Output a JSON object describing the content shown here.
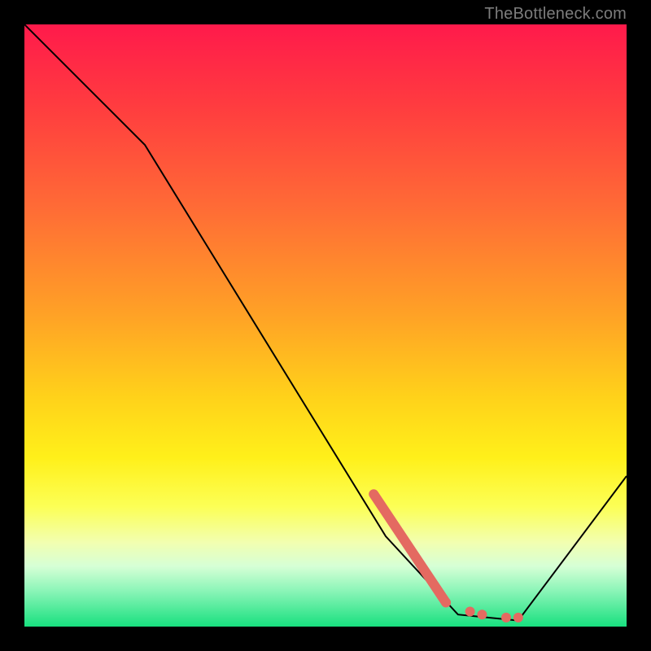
{
  "watermark": {
    "text": "TheBottleneck.com"
  },
  "gradient": {
    "stops": [
      {
        "offset": "0%",
        "color": "#ff1a4b"
      },
      {
        "offset": "14%",
        "color": "#ff3d3f"
      },
      {
        "offset": "30%",
        "color": "#ff6a36"
      },
      {
        "offset": "48%",
        "color": "#ffa126"
      },
      {
        "offset": "62%",
        "color": "#ffd21a"
      },
      {
        "offset": "72%",
        "color": "#fff01a"
      },
      {
        "offset": "80%",
        "color": "#fcff55"
      },
      {
        "offset": "86%",
        "color": "#f2ffb0"
      },
      {
        "offset": "90%",
        "color": "#d6ffd6"
      },
      {
        "offset": "94%",
        "color": "#8cf5b8"
      },
      {
        "offset": "100%",
        "color": "#18e07f"
      }
    ]
  },
  "chart_data": {
    "type": "line",
    "title": "",
    "xlabel": "",
    "ylabel": "",
    "xlim": [
      0,
      100
    ],
    "ylim": [
      0,
      100
    ],
    "series": [
      {
        "name": "curve",
        "points": [
          {
            "x": 0,
            "y": 100
          },
          {
            "x": 20,
            "y": 80
          },
          {
            "x": 60,
            "y": 15
          },
          {
            "x": 72,
            "y": 2
          },
          {
            "x": 82,
            "y": 1
          },
          {
            "x": 100,
            "y": 25
          }
        ],
        "stroke": "#000000",
        "stroke_width": 2
      }
    ],
    "highlight": {
      "color": "#e46a61",
      "segment": [
        {
          "x": 58,
          "y": 22
        },
        {
          "x": 70,
          "y": 4
        }
      ],
      "dots": [
        {
          "x": 70,
          "y": 4
        },
        {
          "x": 74,
          "y": 2.5
        },
        {
          "x": 76,
          "y": 2
        },
        {
          "x": 80,
          "y": 1.5
        },
        {
          "x": 82,
          "y": 1.5
        }
      ]
    }
  }
}
